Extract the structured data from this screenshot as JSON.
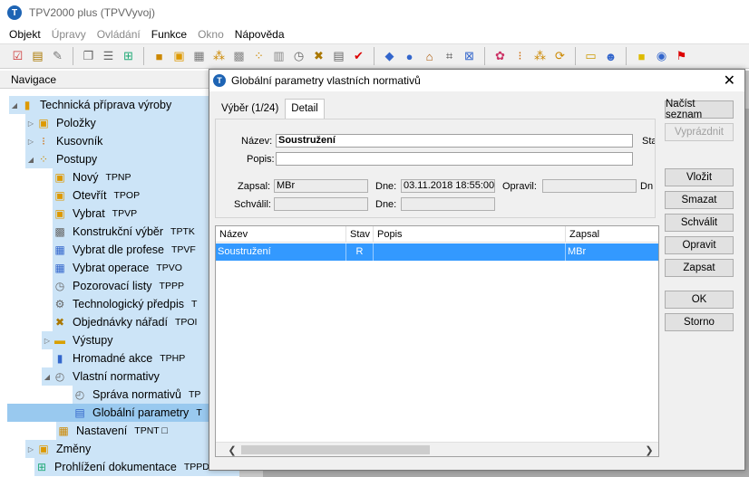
{
  "app": {
    "title": "TPV2000 plus (TPVVyvoj)",
    "logo_letter": "T"
  },
  "menu": [
    "Objekt",
    "Úpravy",
    "Ovládání",
    "Funkce",
    "Okno",
    "Nápověda"
  ],
  "nav": {
    "header": "Navigace",
    "items": [
      {
        "label": "Technická příprava výroby",
        "code": ""
      },
      {
        "label": "Položky",
        "code": ""
      },
      {
        "label": "Kusovník",
        "code": ""
      },
      {
        "label": "Postupy",
        "code": ""
      },
      {
        "label": "Nový",
        "code": "TPNP"
      },
      {
        "label": "Otevřít",
        "code": "TPOP"
      },
      {
        "label": "Vybrat",
        "code": "TPVP"
      },
      {
        "label": "Konstrukční výběr",
        "code": "TPTK"
      },
      {
        "label": "Vybrat dle profese",
        "code": "TPVF"
      },
      {
        "label": "Vybrat operace",
        "code": "TPVO"
      },
      {
        "label": "Pozorovací listy",
        "code": "TPPP"
      },
      {
        "label": "Technologický předpis",
        "code": "T"
      },
      {
        "label": "Objednávky nářadí",
        "code": "TPOI"
      },
      {
        "label": "Výstupy",
        "code": ""
      },
      {
        "label": "Hromadné akce",
        "code": "TPHP"
      },
      {
        "label": "Vlastní normativy",
        "code": ""
      },
      {
        "label": "Správa normativů",
        "code": "TP"
      },
      {
        "label": "Globální parametry",
        "code": "T"
      },
      {
        "label": "Nastavení",
        "code": "TPNT □"
      },
      {
        "label": "Změny",
        "code": ""
      },
      {
        "label": "Prohlížení dokumentace",
        "code": "TPPD"
      }
    ]
  },
  "dialog": {
    "title": "Globální parametry vlastních normativů",
    "tabs": [
      "Výběr (1/24)",
      "Detail"
    ],
    "form": {
      "nazev_label": "Název:",
      "nazev_value": "Soustružení",
      "popis_label": "Popis:",
      "popis_value": "",
      "stav_label": "Sta",
      "zapsal_label": "Zapsal:",
      "zapsal_value": "MBr",
      "dne_label": "Dne:",
      "dne_value": "03.11.2018 18:55:00",
      "opravil_label": "Opravil:",
      "opravil_value": "",
      "dne2_label": "Dn",
      "schvalil_label": "Schválil:",
      "schvalil_value": "",
      "dne3_label": "Dne:",
      "dne3_value": ""
    },
    "grid": {
      "columns": [
        "Název",
        "Stav",
        "Popis",
        "Zapsal"
      ],
      "rows": [
        {
          "nazev": "Soustružení",
          "stav": "R",
          "popis": "",
          "zapsal": "MBr"
        }
      ]
    },
    "buttons": {
      "nacist": "Načíst seznam",
      "vyprazdnit": "Vyprázdnit",
      "vlozit": "Vložit",
      "smazat": "Smazat",
      "schvalit": "Schválit",
      "opravit": "Opravit",
      "zapsat": "Zapsat",
      "ok": "OK",
      "storno": "Storno"
    }
  },
  "colors": {
    "accent": "#3399ff",
    "nav_highlight": "#cce4f7",
    "nav_selected": "#99c9ef",
    "logo": "#1e64b4"
  }
}
